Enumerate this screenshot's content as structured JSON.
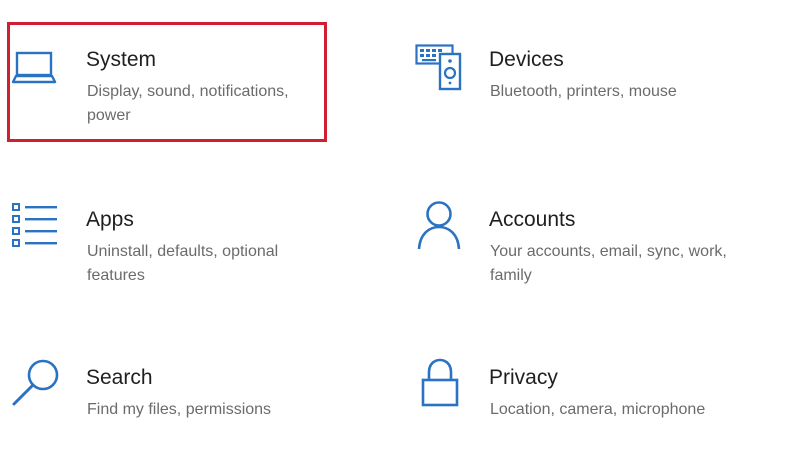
{
  "accent_color": "#2b73c2",
  "selection_color": "#d01f30",
  "settings_tiles": [
    {
      "title": "System",
      "description": "Display, sound, notifications, power",
      "icon": "laptop-icon",
      "selected": true
    },
    {
      "title": "Devices",
      "description": "Bluetooth, printers, mouse",
      "icon": "devices-icon",
      "selected": false
    },
    {
      "title": "Apps",
      "description": "Uninstall, defaults, optional features",
      "icon": "apps-list-icon",
      "selected": false
    },
    {
      "title": "Accounts",
      "description": "Your accounts, email, sync, work, family",
      "icon": "person-icon",
      "selected": false
    },
    {
      "title": "Search",
      "description": "Find my files, permissions",
      "icon": "search-icon",
      "selected": false
    },
    {
      "title": "Privacy",
      "description": "Location, camera, microphone",
      "icon": "lock-icon",
      "selected": false
    }
  ]
}
